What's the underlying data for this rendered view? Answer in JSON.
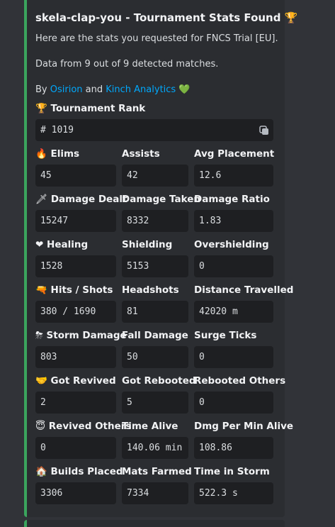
{
  "embed": {
    "title": "skela-clap-you - Tournament Stats Found",
    "title_emoji": "🏆",
    "line1": "Here are the stats you requested for FNCS Trial [EU].",
    "line2": "Data from 9 out of 9 detected matches.",
    "by_prefix": "By ",
    "by_link1": "Osirion",
    "by_and": " and ",
    "by_link2": "Kinch Analytics",
    "by_emoji": "💚",
    "accent_color": "#3ba55d",
    "link_color": "#00a8fc"
  },
  "rank": {
    "label": "Tournament Rank",
    "emoji": "🏆",
    "value": "# 1019",
    "copy_icon": "copy-icon"
  },
  "fields": [
    {
      "emoji": "🔥",
      "label": "Elims",
      "value": "45"
    },
    {
      "emoji": "",
      "label": "Assists",
      "value": "42"
    },
    {
      "emoji": "",
      "label": "Avg Placement",
      "value": "12.6"
    },
    {
      "emoji": "🗡",
      "label": "Damage Dealt",
      "value": "15247"
    },
    {
      "emoji": "",
      "label": "Damage Taken",
      "value": "8332"
    },
    {
      "emoji": "",
      "label": "Damage Ratio",
      "value": "1.83"
    },
    {
      "emoji": "❤",
      "label": "Healing",
      "value": "1528"
    },
    {
      "emoji": "",
      "label": "Shielding",
      "value": "5153"
    },
    {
      "emoji": "",
      "label": "Overshielding",
      "value": "0"
    },
    {
      "emoji": "🔫",
      "label": "Hits / Shots",
      "value": "380 / 1690"
    },
    {
      "emoji": "",
      "label": "Headshots",
      "value": "81"
    },
    {
      "emoji": "",
      "label": "Distance Travelled",
      "value": "42020 m"
    },
    {
      "emoji": "⛈",
      "label": "Storm Damage",
      "value": "803"
    },
    {
      "emoji": "",
      "label": "Fall Damage",
      "value": "50"
    },
    {
      "emoji": "",
      "label": "Surge Ticks",
      "value": "0"
    },
    {
      "emoji": "🤝",
      "label": "Got Revived",
      "value": "2"
    },
    {
      "emoji": "",
      "label": "Got Rebooted",
      "value": "5"
    },
    {
      "emoji": "",
      "label": "Rebooted Others",
      "value": "0"
    },
    {
      "emoji": "😇",
      "label": "Revived Others",
      "value": "0"
    },
    {
      "emoji": "",
      "label": "Time Alive",
      "value": "140.06 min"
    },
    {
      "emoji": "",
      "label": "Dmg Per Min Alive",
      "value": "108.86"
    },
    {
      "emoji": "🏠",
      "label": "Builds Placed",
      "value": "3306"
    },
    {
      "emoji": "",
      "label": "Mats Farmed",
      "value": "7334"
    },
    {
      "emoji": "",
      "label": "Time in Storm",
      "value": "522.3 s"
    }
  ]
}
